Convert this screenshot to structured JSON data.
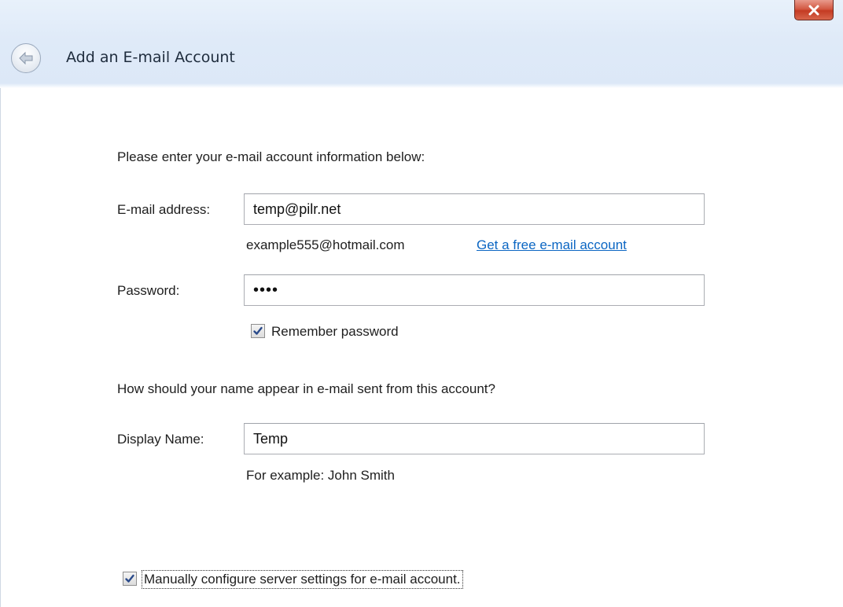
{
  "dialog": {
    "title": "Add an E-mail Account"
  },
  "icons": {
    "close": "close-icon",
    "back": "back-arrow-icon",
    "check": "checkmark-icon"
  },
  "colors": {
    "close_button": "#c43b23",
    "link": "#0b66c3",
    "header": "#dfeaf8"
  },
  "form": {
    "intro": "Please enter your e-mail account information below:",
    "email": {
      "label": "E-mail address:",
      "value": "temp@pilr.net",
      "example": "example555@hotmail.com",
      "free_account_link": "Get a free e-mail account"
    },
    "password": {
      "label": "Password:",
      "value": "abcd",
      "remember_label": "Remember password",
      "remember_checked": true
    },
    "display_name_section": {
      "question": "How should your name appear in e-mail sent from this account?",
      "label": "Display Name:",
      "value": "Temp",
      "example": "For example: John Smith"
    },
    "manual_config": {
      "label": "Manually configure server settings for e-mail account.",
      "checked": true
    }
  }
}
